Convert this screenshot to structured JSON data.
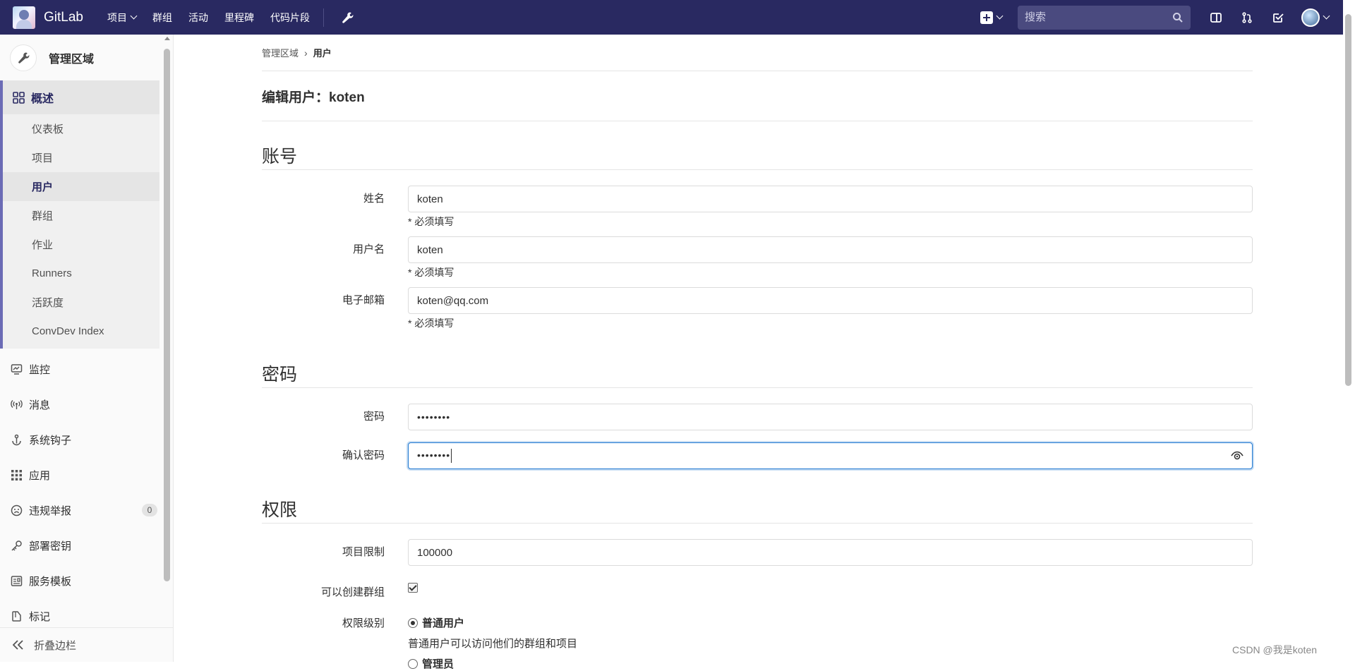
{
  "navbar": {
    "brand": "GitLab",
    "links": [
      "项目",
      "群组",
      "活动",
      "里程碑",
      "代码片段"
    ],
    "search_placeholder": "搜索"
  },
  "sidebar": {
    "title": "管理区域",
    "overview": {
      "label": "概述",
      "items": [
        "仪表板",
        "项目",
        "用户",
        "群组",
        "作业",
        "Runners",
        "活跃度",
        "ConvDev Index"
      ]
    },
    "items": [
      {
        "label": "监控",
        "icon": "monitor-icon"
      },
      {
        "label": "消息",
        "icon": "broadcast-icon"
      },
      {
        "label": "系统钩子",
        "icon": "hook-icon"
      },
      {
        "label": "应用",
        "icon": "apps-icon"
      },
      {
        "label": "违规举报",
        "icon": "abuse-icon",
        "badge": "0"
      },
      {
        "label": "部署密钥",
        "icon": "key-icon"
      },
      {
        "label": "服务模板",
        "icon": "template-icon"
      },
      {
        "label": "标记",
        "icon": "label-icon"
      }
    ],
    "collapse": "折叠边栏"
  },
  "breadcrumb": {
    "parent": "管理区域",
    "current": "用户"
  },
  "page_title": "编辑用户：koten",
  "sections": {
    "account": {
      "title": "账号",
      "name_label": "姓名",
      "name_value": "koten",
      "username_label": "用户名",
      "username_value": "koten",
      "email_label": "电子邮箱",
      "email_value": "koten@qq.com",
      "required_hint": "* 必须填写"
    },
    "password": {
      "title": "密码",
      "password_label": "密码",
      "password_value": "••••••••",
      "confirm_label": "确认密码",
      "confirm_value": "••••••••"
    },
    "access": {
      "title": "权限",
      "projects_limit_label": "项目限制",
      "projects_limit_value": "100000",
      "can_create_group_label": "可以创建群组",
      "access_level_label": "权限级别",
      "regular_label": "普通用户",
      "regular_desc": "普通用户可以访问他们的群组和项目",
      "admin_label": "管理员"
    }
  },
  "watermark": "CSDN @我是koten"
}
